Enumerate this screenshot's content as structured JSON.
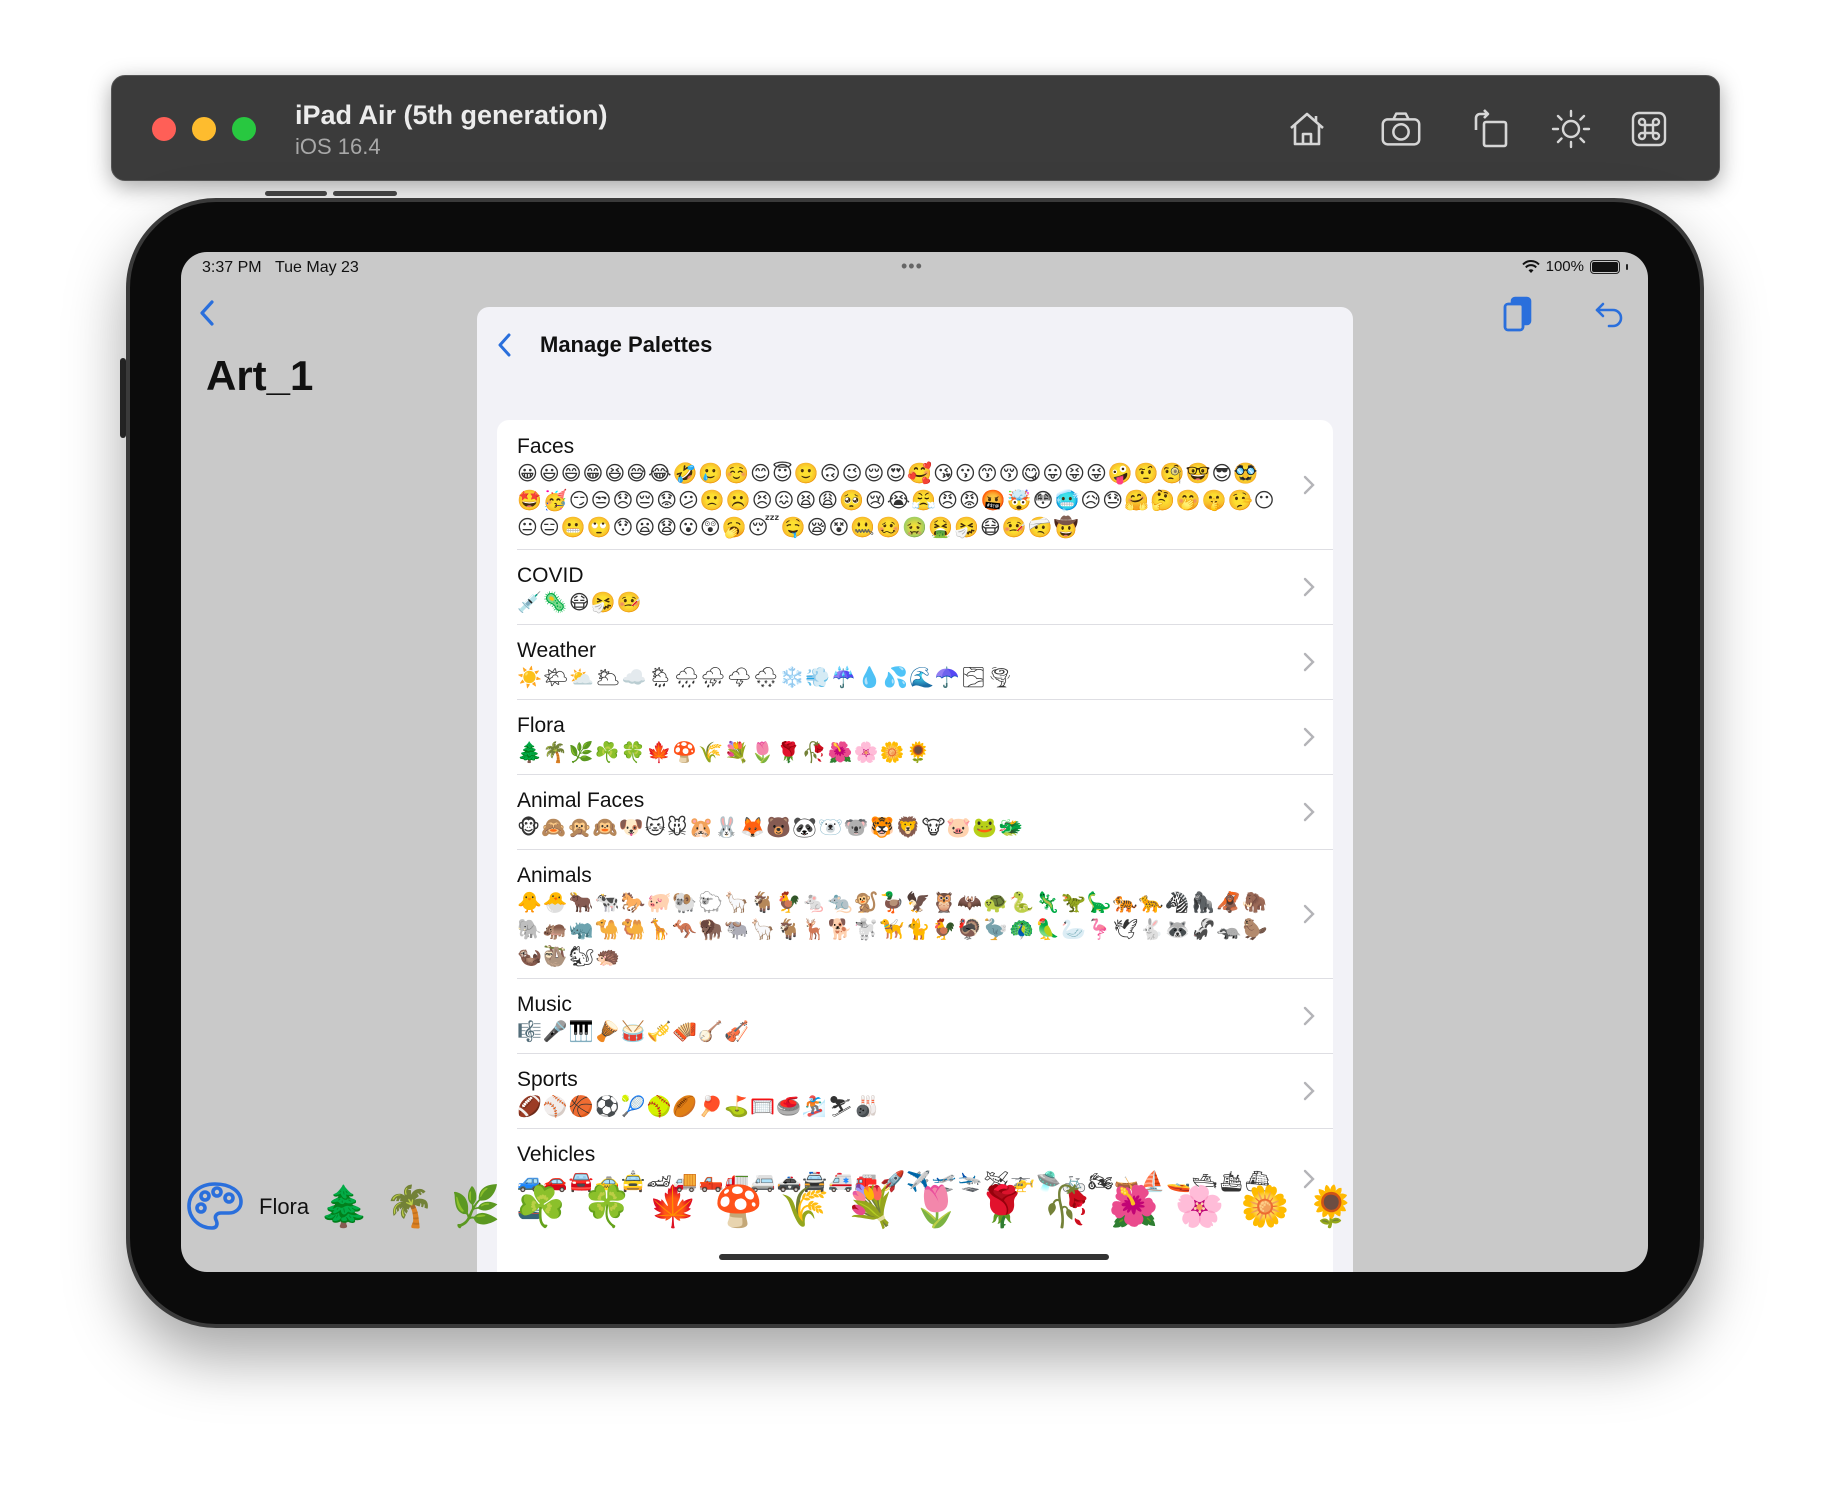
{
  "simulator": {
    "device_name": "iPad Air (5th generation)",
    "os_version": "iOS 16.4",
    "toolbar_icons": [
      "home-icon",
      "camera-icon",
      "rotate-icon",
      "brightness-icon",
      "command-icon"
    ]
  },
  "status_bar": {
    "time": "3:37 PM",
    "date": "Tue May 23",
    "dots": "•••",
    "battery": "100%"
  },
  "document": {
    "title": "Art_1"
  },
  "sheet": {
    "title": "Manage Palettes",
    "palettes": [
      {
        "name": "Faces",
        "emojis": "😀😃😄😁😆😅😂🤣🥲☺️😊😇🙂🙃😉😌😍🥰😘😗😙😚😋😛😝😜🤪🤨🧐🤓😎🥸🤩🥳😏😒😞😔😟😕🙁☹️😣😖😫😩🥺😢😭😤😠😡🤬🤯😳🥶😥😓🤗🤔🤭🤫🤥😶😐😑😬🙄😯😦😧😮😲🥱😴🤤😪😵🤐🥴🤢🤮🤧😷🤒🤕🤠"
      },
      {
        "name": "COVID",
        "emojis": "💉🦠😷🤧🤒"
      },
      {
        "name": "Weather",
        "emojis": "☀️🌤⛅️🌥☁️🌦🌧⛈🌩🌨❄️💨☔️💧💦🌊☂️🌫🌪"
      },
      {
        "name": "Flora",
        "emojis": "🌲🌴🌿☘️🍀🍁🍄🌾💐🌷🌹🥀🌺🌸🌼🌻"
      },
      {
        "name": "Animal Faces",
        "emojis": "🐵🙈🙊🙉🐶🐱🐭🐹🐰🦊🐻🐼🐻‍❄️🐨🐯🦁🐮🐷🐸🐲"
      },
      {
        "name": "Animals",
        "emojis": "🐥🐣🐂🐄🐎🐖🐏🐑🦙🐐🐓🐁🐀🐒🦆🦅🦉🦇🐢🐍🦎🦖🦕🐅🐆🦓🦍🦧🦣🐘🦛🦏🐪🐫🦒🦘🦬🐃🦙🐐🦌🐕🐩🦮🐈🐓🦃🦤🦚🦜🦢🦩🕊🐇🦝🦨🦡🦫🦦🦥🐿🦔"
      },
      {
        "name": "Music",
        "emojis": "🎼🎤🎹🪘🥁🎺🪗🪕🎻"
      },
      {
        "name": "Sports",
        "emojis": "🏈⚾️🏀⚽️🎾🥎🏉🏓⛳️🥅🥌🏂⛷🎳"
      },
      {
        "name": "Vehicles",
        "emojis": "🚙🚗🚘🚕🚖🏎🚚🛻🚛🚐🚓🚔🚑🚒🚀✈️🛫🛬🛩🚁🛸🚲🏍🛶⛵️🚤🛥🛳⛴🚢"
      }
    ]
  },
  "palette_bar": {
    "name": "Flora",
    "emojis": "🌲🌴🌿☘️🍀🍁🍄🌾💐🌷🌹🥀🌺🌸🌼🌻"
  },
  "colors": {
    "accent": "#2a6fdc",
    "screen_background": "#c9c9c9",
    "sheet_background": "#f2f2f7"
  }
}
